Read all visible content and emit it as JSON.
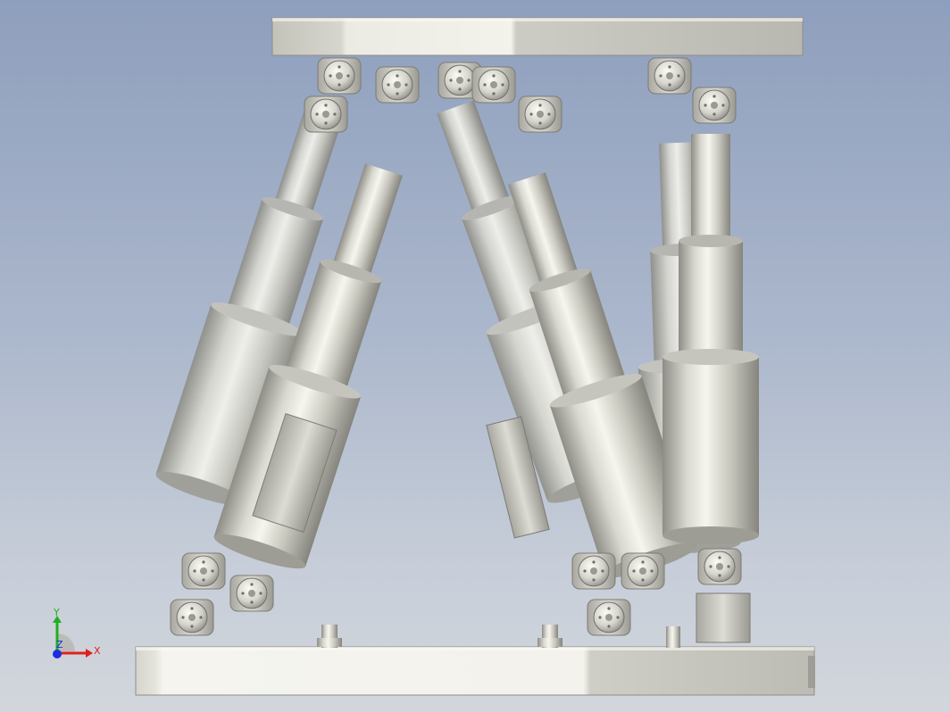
{
  "viewport": {
    "background_top": "#8e9fbd",
    "background_bottom": "#d2d6dc",
    "model_colors": {
      "metal_light": "#f2f1ea",
      "metal_mid": "#cfcec6",
      "metal_dark": "#8d8c86",
      "hole": "#9a9a95"
    }
  },
  "triad": {
    "x_label": "X",
    "y_label": "Y",
    "z_label": "Z",
    "x_color": "#e0201c",
    "y_color": "#1fb01f",
    "z_color": "#1a2ee0"
  }
}
